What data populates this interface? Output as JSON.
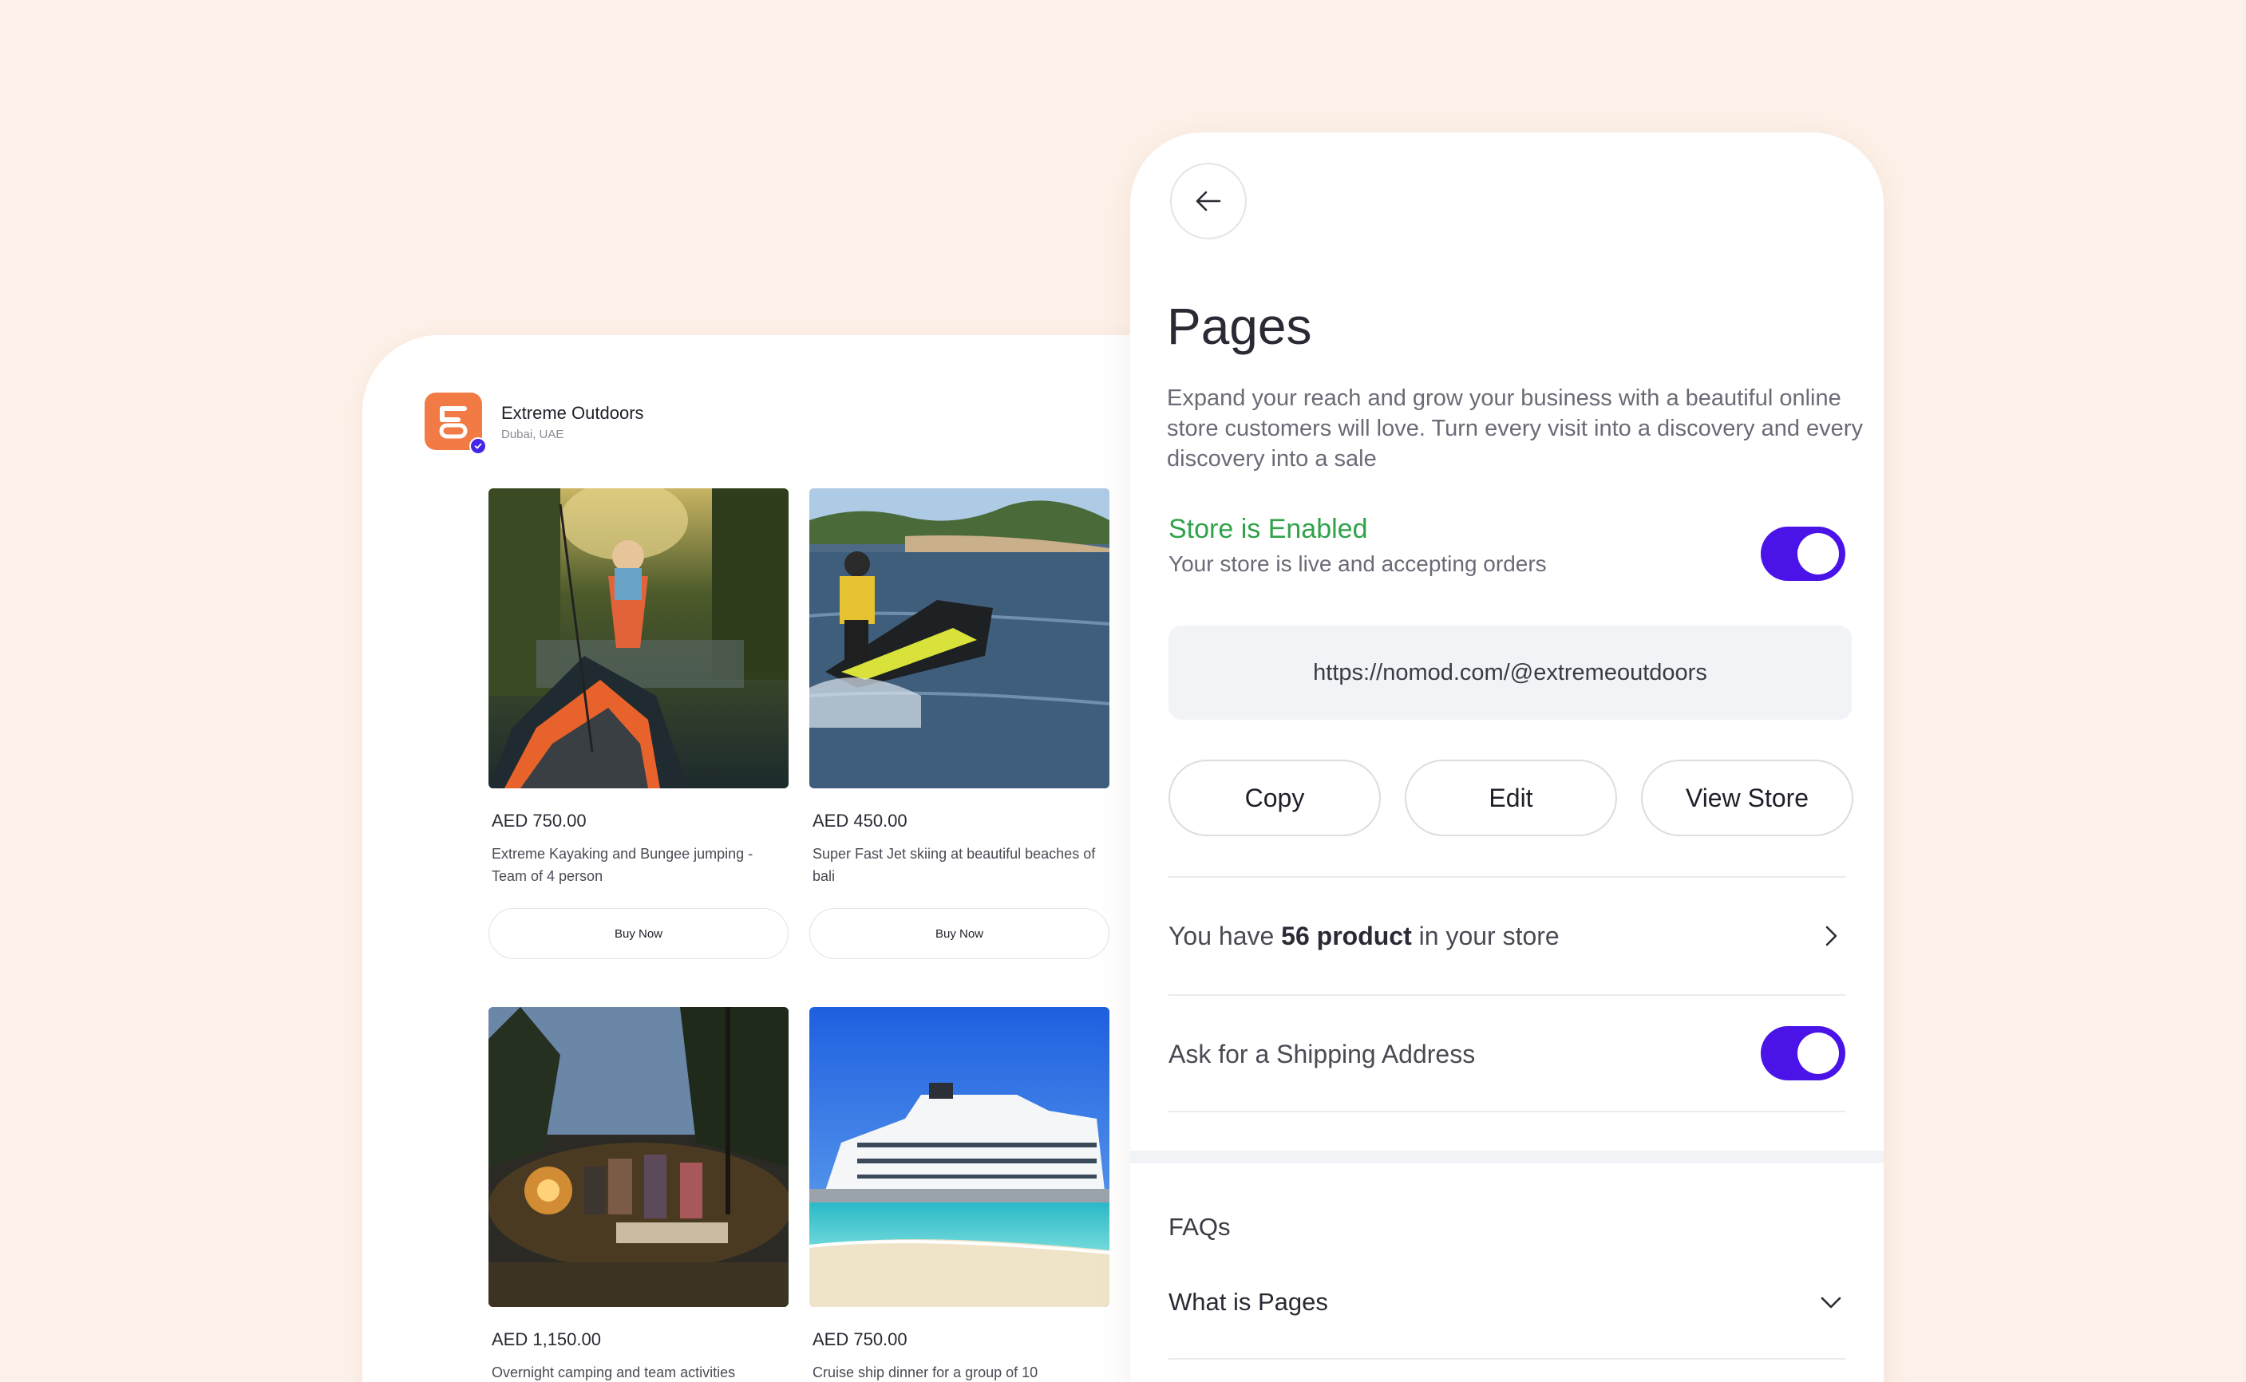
{
  "store": {
    "name": "Extreme Outdoors",
    "location": "Dubai, UAE",
    "products": [
      {
        "image_icon": "kayak-photo",
        "price": "AED 750.00",
        "description": "Extreme Kayaking and Bungee jumping - Team of 4 person",
        "button_label": "Buy Now"
      },
      {
        "image_icon": "jetski-photo",
        "price": "AED 450.00",
        "description": "Super Fast Jet skiing at beautiful beaches of bali",
        "button_label": "Buy Now"
      },
      {
        "image_icon": "campfire-photo",
        "price": "AED 1,150.00",
        "description": "Overnight camping and team activities",
        "button_label": ""
      },
      {
        "image_icon": "cruise-ship-photo",
        "price": "AED 750.00",
        "description": "Cruise ship dinner for a group of 10",
        "button_label": ""
      }
    ]
  },
  "pages": {
    "title": "Pages",
    "description": "Expand your reach and grow your business with a beautiful online store customers will love. Turn every visit into a discovery and every discovery into a sale",
    "store_status": {
      "title": "Store is Enabled",
      "subtitle": "Your store is live and accepting orders",
      "enabled": true
    },
    "store_url": "https://nomod.com/@extremeoutdoors",
    "actions": {
      "copy": "Copy",
      "edit": "Edit",
      "view_store": "View Store"
    },
    "products_row": {
      "prefix": "You have ",
      "count": "56 product",
      "suffix": " in your store"
    },
    "shipping": {
      "label": "Ask for a Shipping Address",
      "enabled": true
    },
    "faqs": {
      "title": "FAQs",
      "items": [
        {
          "question": "What is Pages"
        }
      ]
    }
  },
  "colors": {
    "background": "#fdf1e9",
    "accent": "#4a14e8",
    "success": "#2fa24a",
    "brand_orange": "#f27a45"
  }
}
